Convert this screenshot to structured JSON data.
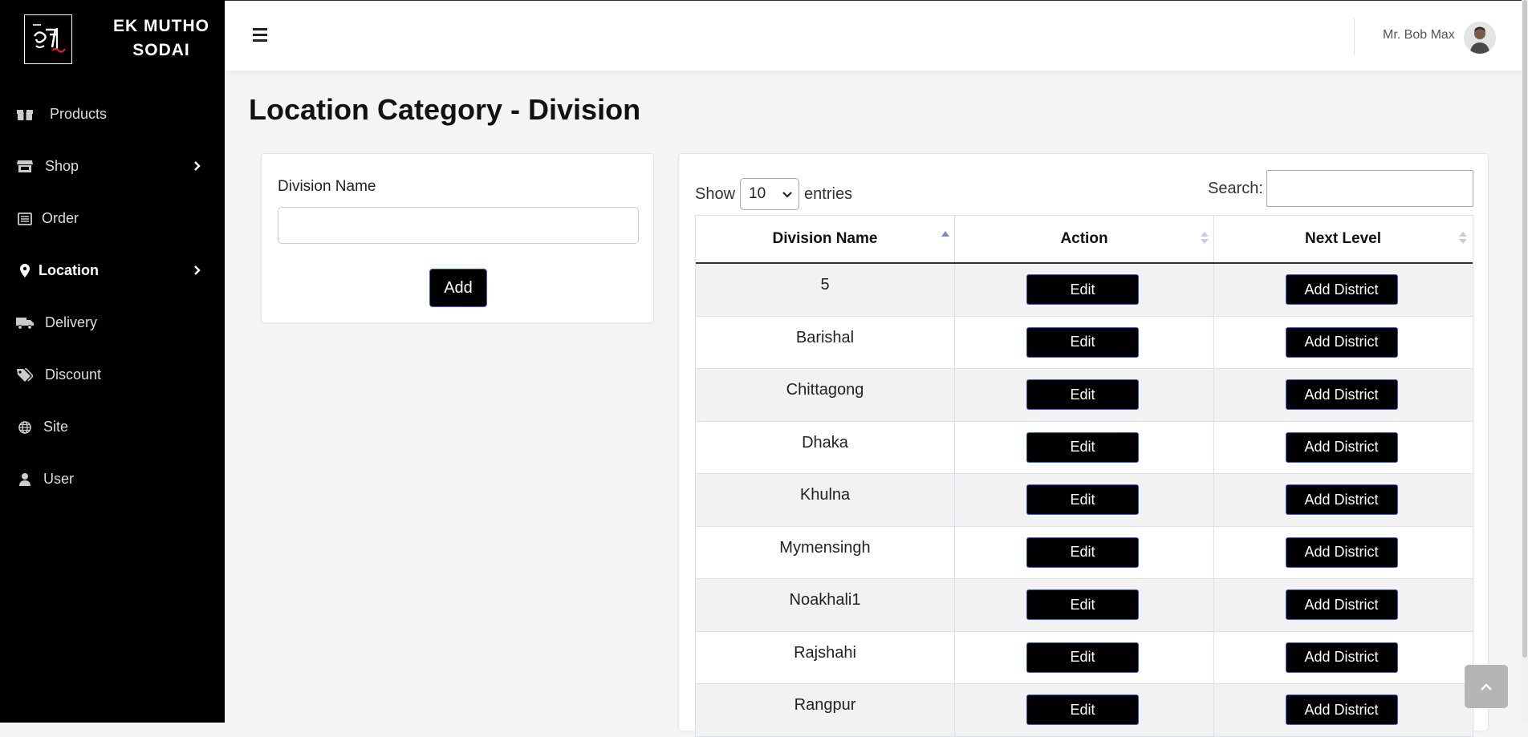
{
  "brand": {
    "name_line1": "EK MUTHO",
    "name_line2": "SODAI"
  },
  "sidebar": {
    "items": [
      {
        "label": "Products",
        "icon": "box-icon",
        "has_submenu": false,
        "active": false
      },
      {
        "label": "Shop",
        "icon": "store-icon",
        "has_submenu": true,
        "active": false
      },
      {
        "label": "Order",
        "icon": "list-icon",
        "has_submenu": false,
        "active": false
      },
      {
        "label": "Location",
        "icon": "map-pin-icon",
        "has_submenu": true,
        "active": true
      },
      {
        "label": "Delivery",
        "icon": "truck-icon",
        "has_submenu": false,
        "active": false
      },
      {
        "label": "Discount",
        "icon": "tags-icon",
        "has_submenu": false,
        "active": false
      },
      {
        "label": "Site",
        "icon": "globe-icon",
        "has_submenu": false,
        "active": false
      },
      {
        "label": "User",
        "icon": "user-icon",
        "has_submenu": false,
        "active": false
      }
    ]
  },
  "header": {
    "username": "Mr. Bob Max"
  },
  "page": {
    "title": "Location Category - Division"
  },
  "form": {
    "field_label": "Division Name",
    "field_value": "",
    "add_label": "Add"
  },
  "table": {
    "show_label": "Show",
    "entries_value": "10",
    "entries_label": "entries",
    "search_label": "Search:",
    "search_value": "",
    "columns": [
      "Division Name",
      "Action",
      "Next Level"
    ],
    "sort_column": "Division Name",
    "sort_direction": "asc",
    "edit_label": "Edit",
    "next_level_label": "Add District",
    "rows": [
      "5",
      "Barishal",
      "Chittagong",
      "Dhaka",
      "Khulna",
      "Mymensingh",
      "Noakhali1",
      "Rajshahi",
      "Rangpur"
    ]
  },
  "colors": {
    "sidebar_bg": "#000000",
    "button_bg": "#000000",
    "button_border": "#3b5bdb",
    "accent": "#7b8bd6"
  }
}
